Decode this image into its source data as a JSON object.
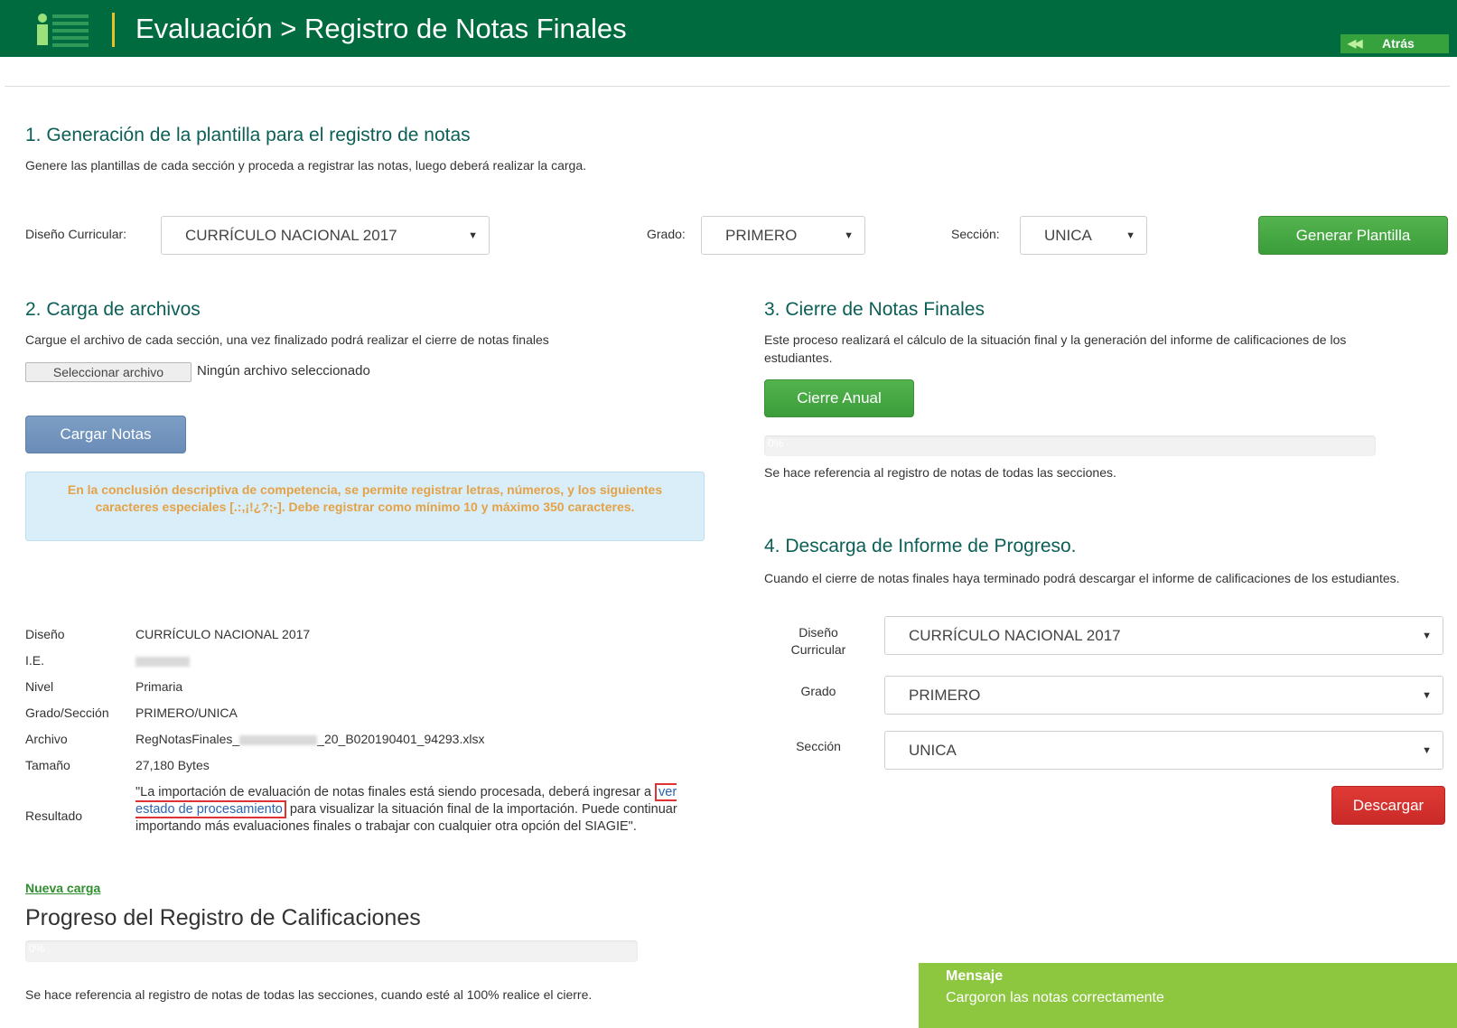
{
  "header": {
    "title": "Evaluación > Registro de Notas Finales",
    "back_label": "Atrás"
  },
  "section1": {
    "title": "1. Generación de la plantilla para el registro de notas",
    "description": "Genere las plantillas de cada sección y proceda a registrar las notas, luego deberá realizar la carga.",
    "curriculum_label": "Diseño Curricular:",
    "curriculum_value": "CURRÍCULO NACIONAL 2017",
    "grade_label": "Grado:",
    "grade_value": "PRIMERO",
    "section_label": "Sección:",
    "section_value": "UNICA",
    "generate_label": "Generar Plantilla"
  },
  "section2": {
    "title": "2. Carga de archivos",
    "description": "Cargue el archivo de cada sección, una vez finalizado podrá realizar el cierre de notas finales",
    "file_button": "Seleccionar archivo",
    "file_none": "Ningún archivo seleccionado",
    "upload_label": "Cargar Notas",
    "alert": "En la conclusión descriptiva de competencia, se permite registrar letras, números, y los siguientes caracteres especiales [.:,¡!¿?;-]. Debe registrar como mínimo 10 y máximo 350 caracteres."
  },
  "info": {
    "design_label": "Diseño",
    "design_value": "CURRÍCULO NACIONAL 2017",
    "ie_label": "I.E.",
    "level_label": "Nivel",
    "level_value": "Primaria",
    "grade_section_label": "Grado/Sección",
    "grade_section_value": "PRIMERO/UNICA",
    "file_label": "Archivo",
    "file_value_prefix": "RegNotasFinales_",
    "file_value_suffix": "_20_B020190401_94293.xlsx",
    "size_label": "Tamaño",
    "size_value": "27,180 Bytes",
    "result_label": "Resultado",
    "result_before": "\"La importación de evaluación de notas finales está siendo procesada, deberá ingresar a ",
    "result_link": "ver estado de procesamiento",
    "result_after": " para visualizar la situación final de la importación. Puede continuar importando más evaluaciones finales o trabajar con cualquier otra opción del SIAGIE\"."
  },
  "progress_section": {
    "new_load": "Nueva carga",
    "title": "Progreso del Registro de Calificaciones",
    "percent_label": "0%",
    "percent": 0,
    "note": "Se hace referencia al registro de notas de todas las secciones, cuando esté al 100% realice el cierre."
  },
  "section3": {
    "title": "3. Cierre de Notas Finales",
    "description": "Este proceso realizará el cálculo de la situación final y la generación del informe de calificaciones de los estudiantes.",
    "close_label": "Cierre Anual",
    "percent_label": "0%",
    "percent": 0,
    "note": "Se hace referencia al registro de notas de todas las secciones."
  },
  "section4": {
    "title": "4. Descarga de Informe de Progreso.",
    "description": "Cuando el cierre de notas finales haya terminado podrá descargar el informe de calificaciones de los estudiantes.",
    "curriculum_label_1": "Diseño",
    "curriculum_label_2": "Curricular",
    "curriculum_value": "CURRÍCULO NACIONAL 2017",
    "grade_label": "Grado",
    "grade_value": "PRIMERO",
    "section_label": "Sección",
    "section_value": "UNICA",
    "download_label": "Descargar"
  },
  "toast": {
    "title": "Mensaje",
    "message": "Cargoron las notas correctamente"
  },
  "colors": {
    "header_bg": "#006b3f",
    "accent_green": "#3b9d3a",
    "danger_red": "#c92a27",
    "section_title": "#0b5f56",
    "toast_bg": "#8dc63f"
  }
}
